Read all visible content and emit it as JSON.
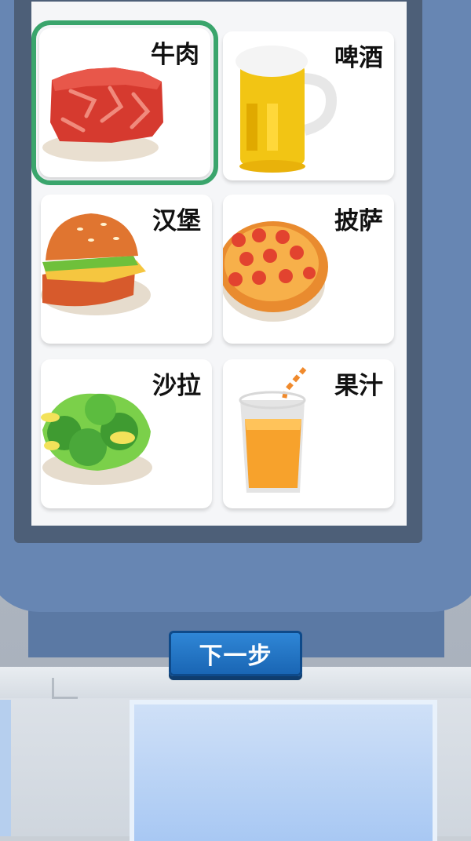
{
  "menu": {
    "items": [
      {
        "label": "牛肉",
        "icon": "beef-steak-icon",
        "selected": true
      },
      {
        "label": "啤酒",
        "icon": "beer-mug-icon",
        "selected": false
      },
      {
        "label": "汉堡",
        "icon": "burger-icon",
        "selected": false
      },
      {
        "label": "披萨",
        "icon": "pizza-icon",
        "selected": false
      },
      {
        "label": "沙拉",
        "icon": "salad-icon",
        "selected": false
      },
      {
        "label": "果汁",
        "icon": "juice-glass-icon",
        "selected": false
      }
    ]
  },
  "next_button": {
    "label": "下一步"
  },
  "colors": {
    "selected_outline": "#3aa56c",
    "button": "#1f74c4",
    "kiosk": "#6786b3"
  }
}
